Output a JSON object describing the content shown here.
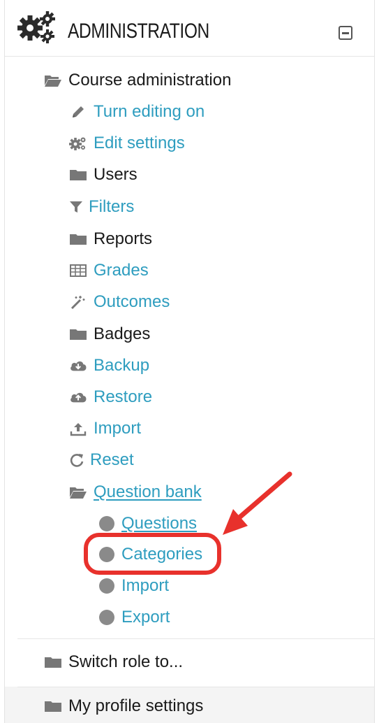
{
  "header": {
    "title": "ADMINISTRATION",
    "icon": "gears-icon",
    "collapse_icon": "collapse-icon"
  },
  "course_admin": {
    "label": "Course administration",
    "icon": "folder-open-icon"
  },
  "items": [
    {
      "label": "Turn editing on",
      "icon": "pencil-icon",
      "link": true
    },
    {
      "label": "Edit settings",
      "icon": "cogs-icon",
      "link": true
    },
    {
      "label": "Users",
      "icon": "folder-icon",
      "link": false
    },
    {
      "label": "Filters",
      "icon": "filter-icon",
      "link": true
    },
    {
      "label": "Reports",
      "icon": "folder-icon",
      "link": false
    },
    {
      "label": "Grades",
      "icon": "table-icon",
      "link": true
    },
    {
      "label": "Outcomes",
      "icon": "magic-wand-icon",
      "link": true
    },
    {
      "label": "Badges",
      "icon": "folder-icon",
      "link": false
    },
    {
      "label": "Backup",
      "icon": "cloud-download-icon",
      "link": true
    },
    {
      "label": "Restore",
      "icon": "cloud-upload-icon",
      "link": true
    },
    {
      "label": "Import",
      "icon": "upload-icon",
      "link": true
    },
    {
      "label": "Reset",
      "icon": "reload-icon",
      "link": true
    }
  ],
  "question_bank": {
    "label": "Question bank",
    "icon": "folder-open-icon",
    "children": [
      {
        "label": "Questions",
        "icon": "bullet-icon"
      },
      {
        "label": "Categories",
        "icon": "bullet-icon"
      },
      {
        "label": "Import",
        "icon": "bullet-icon"
      },
      {
        "label": "Export",
        "icon": "bullet-icon"
      }
    ]
  },
  "switch_role": {
    "label": "Switch role to...",
    "icon": "folder-icon"
  },
  "profile_settings": {
    "label": "My profile settings",
    "icon": "folder-icon"
  },
  "colors": {
    "link": "#2e9dbf",
    "text": "#1a1a1a",
    "icon": "#777777",
    "annotation": "#e8312c"
  }
}
